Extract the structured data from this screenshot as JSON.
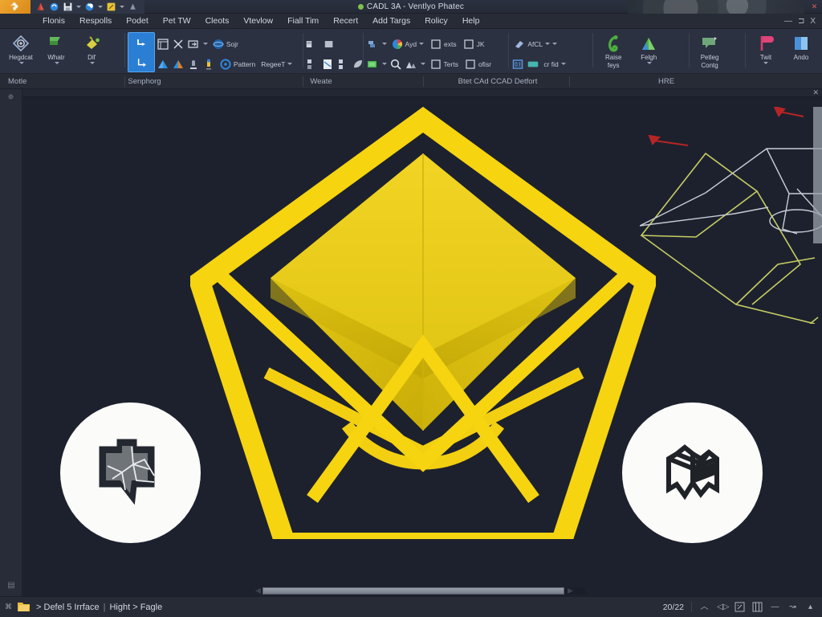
{
  "window": {
    "title": "CADL 3A - Ventlyo Phatec",
    "status_dot_color": "#7fbf4d",
    "buttons": {
      "minimize": "—",
      "maximize": "□",
      "close": "✕"
    }
  },
  "quick_access": {
    "items": [
      {
        "name": "app-menu-icon",
        "color": "#e8a13a"
      },
      {
        "name": "new-file-icon",
        "color": "#c0392b"
      },
      {
        "name": "open-file-icon",
        "color": "#2e86de"
      },
      {
        "name": "save-icon",
        "color": "#e8eaef"
      },
      {
        "name": "undo-icon",
        "color": "#2e86de"
      },
      {
        "name": "redo-icon",
        "color": "#e8c23a"
      },
      {
        "name": "print-icon",
        "color": "#9aa3b4"
      }
    ]
  },
  "menubar": {
    "items": [
      "Flonis",
      "Respolls",
      "Podet",
      "Pet TW",
      "Cleots",
      "Vtevlow",
      "Fiall Tim",
      "Recert",
      "Add Targs",
      "Rolicy",
      "Help"
    ],
    "window_controls": [
      "—",
      "⊐",
      "X"
    ]
  },
  "ribbon": {
    "panels": [
      {
        "caption": "Motle",
        "big_buttons": [
          {
            "label": "Hegdcat",
            "has_caret": true,
            "icon": "diamond-node-icon",
            "color": "#9fb4d6"
          },
          {
            "label": "Whatr",
            "has_caret": true,
            "icon": "green-flag-icon",
            "color": "#62b85a"
          },
          {
            "label": "Dif",
            "has_caret": true,
            "icon": "paint-bucket-icon",
            "color": "#d2c841"
          }
        ]
      },
      {
        "caption": "Senphorg",
        "selected_tool": "extrude-tool",
        "row1": [
          {
            "label": "",
            "icon": "table-icon"
          },
          {
            "label": "",
            "icon": "close-x-icon"
          },
          {
            "label": "",
            "icon": "box-arrow-icon"
          },
          {
            "label": "Sojr",
            "icon": "sphere-icon"
          }
        ],
        "row2": [
          {
            "label": "",
            "icon": "blue-triangle-icon"
          },
          {
            "label": "",
            "icon": "orange-triangle-icon"
          },
          {
            "label": "",
            "icon": "stamp-icon"
          },
          {
            "label": "",
            "icon": "yellow-pin-icon"
          },
          {
            "label": "Pattern",
            "icon": "circle-ring-icon"
          },
          {
            "label": "RegeeT",
            "icon": "regen-icon",
            "has_caret": true
          }
        ]
      },
      {
        "caption": "Weate",
        "row1": [
          {
            "label": "",
            "icon": "panel-left-icon"
          },
          {
            "label": "",
            "icon": "panel-right-icon"
          },
          {
            "label": "",
            "icon": "orange-square-icon"
          }
        ],
        "row2": [
          {
            "label": "",
            "icon": "grid-split-icon"
          },
          {
            "label": "",
            "icon": "page-icon"
          },
          {
            "label": "",
            "icon": "grid-small-icon"
          },
          {
            "label": "",
            "icon": "leaf-icon",
            "has_caret": true
          }
        ]
      },
      {
        "caption": "Btet CAd CCAD Detfort",
        "row1": [
          {
            "label": "",
            "icon": "layers-icon",
            "has_caret": true
          },
          {
            "label": "Ayd",
            "icon": "color-wheel-icon",
            "has_caret": true
          },
          {
            "label": "exts",
            "icon": "checkbox-icon"
          },
          {
            "label": "JK",
            "icon": "checkbox-icon"
          }
        ],
        "row2": [
          {
            "label": "",
            "icon": "green-rect-icon",
            "has_caret": true
          },
          {
            "label": "",
            "icon": "zoom-icon"
          },
          {
            "label": "",
            "icon": "mountain-icon",
            "has_caret": true
          },
          {
            "label": "Terts",
            "icon": "checkbox-icon"
          },
          {
            "label": "ofisr",
            "icon": "checkbox-icon"
          }
        ]
      },
      {
        "caption": "HRE",
        "row1": [
          {
            "label": "AfCL",
            "icon": "eraser-icon",
            "has_caret": true
          }
        ],
        "row2": [
          {
            "label": "",
            "icon": "blue-id-icon"
          },
          {
            "label": "cr fid",
            "icon": "teal-folder-icon",
            "has_caret": true
          }
        ],
        "big_buttons": [
          {
            "label": "Raise",
            "label2": "feys",
            "icon": "green-arc-icon",
            "has_caret": true
          },
          {
            "label": "Felgh",
            "icon": "mountain-green-icon",
            "has_caret": true
          },
          {
            "label": "Petleg",
            "label2": "Contg",
            "icon": "callout-icon",
            "has_caret": true
          },
          {
            "label": "Twit",
            "icon": "pink-flag-icon",
            "has_caret": true
          },
          {
            "label": "Ando",
            "icon": "blue-book-icon",
            "has_caret": true
          }
        ]
      }
    ]
  },
  "viewport": {
    "background_color": "#1d212e",
    "logo": {
      "name": "cad-pentagon-logo",
      "pentagon_color": "#f6d410",
      "gem_color": "#e8c800"
    },
    "badges": [
      {
        "name": "map-bubble-icon",
        "circle_color": "#fbfbfa",
        "glyph_color": "#6e7378"
      },
      {
        "name": "isometric-solid-icon",
        "circle_color": "#fbfbfa",
        "glyph_color": "#1f2328"
      }
    ],
    "wireframe": {
      "name": "cad-wireframe-drawing",
      "line_color_a": "#c6cd62",
      "line_color_b": "#c8ccd6",
      "marker_color": "#b52525"
    },
    "close_label": "✕"
  },
  "statusbar": {
    "breadcrumb": {
      "prefix": ">",
      "segment1": "Defel 5 Irrface",
      "divider": "|",
      "segment2": "Hight",
      "arrow": ">",
      "segment3": "Fagle"
    },
    "counter": "20/22",
    "icons": [
      "chevron-up-icon",
      "annotation-scale-icon",
      "snap-icon",
      "grid-icon",
      "dash-icon",
      "customize-icon",
      "expand-icon"
    ]
  }
}
